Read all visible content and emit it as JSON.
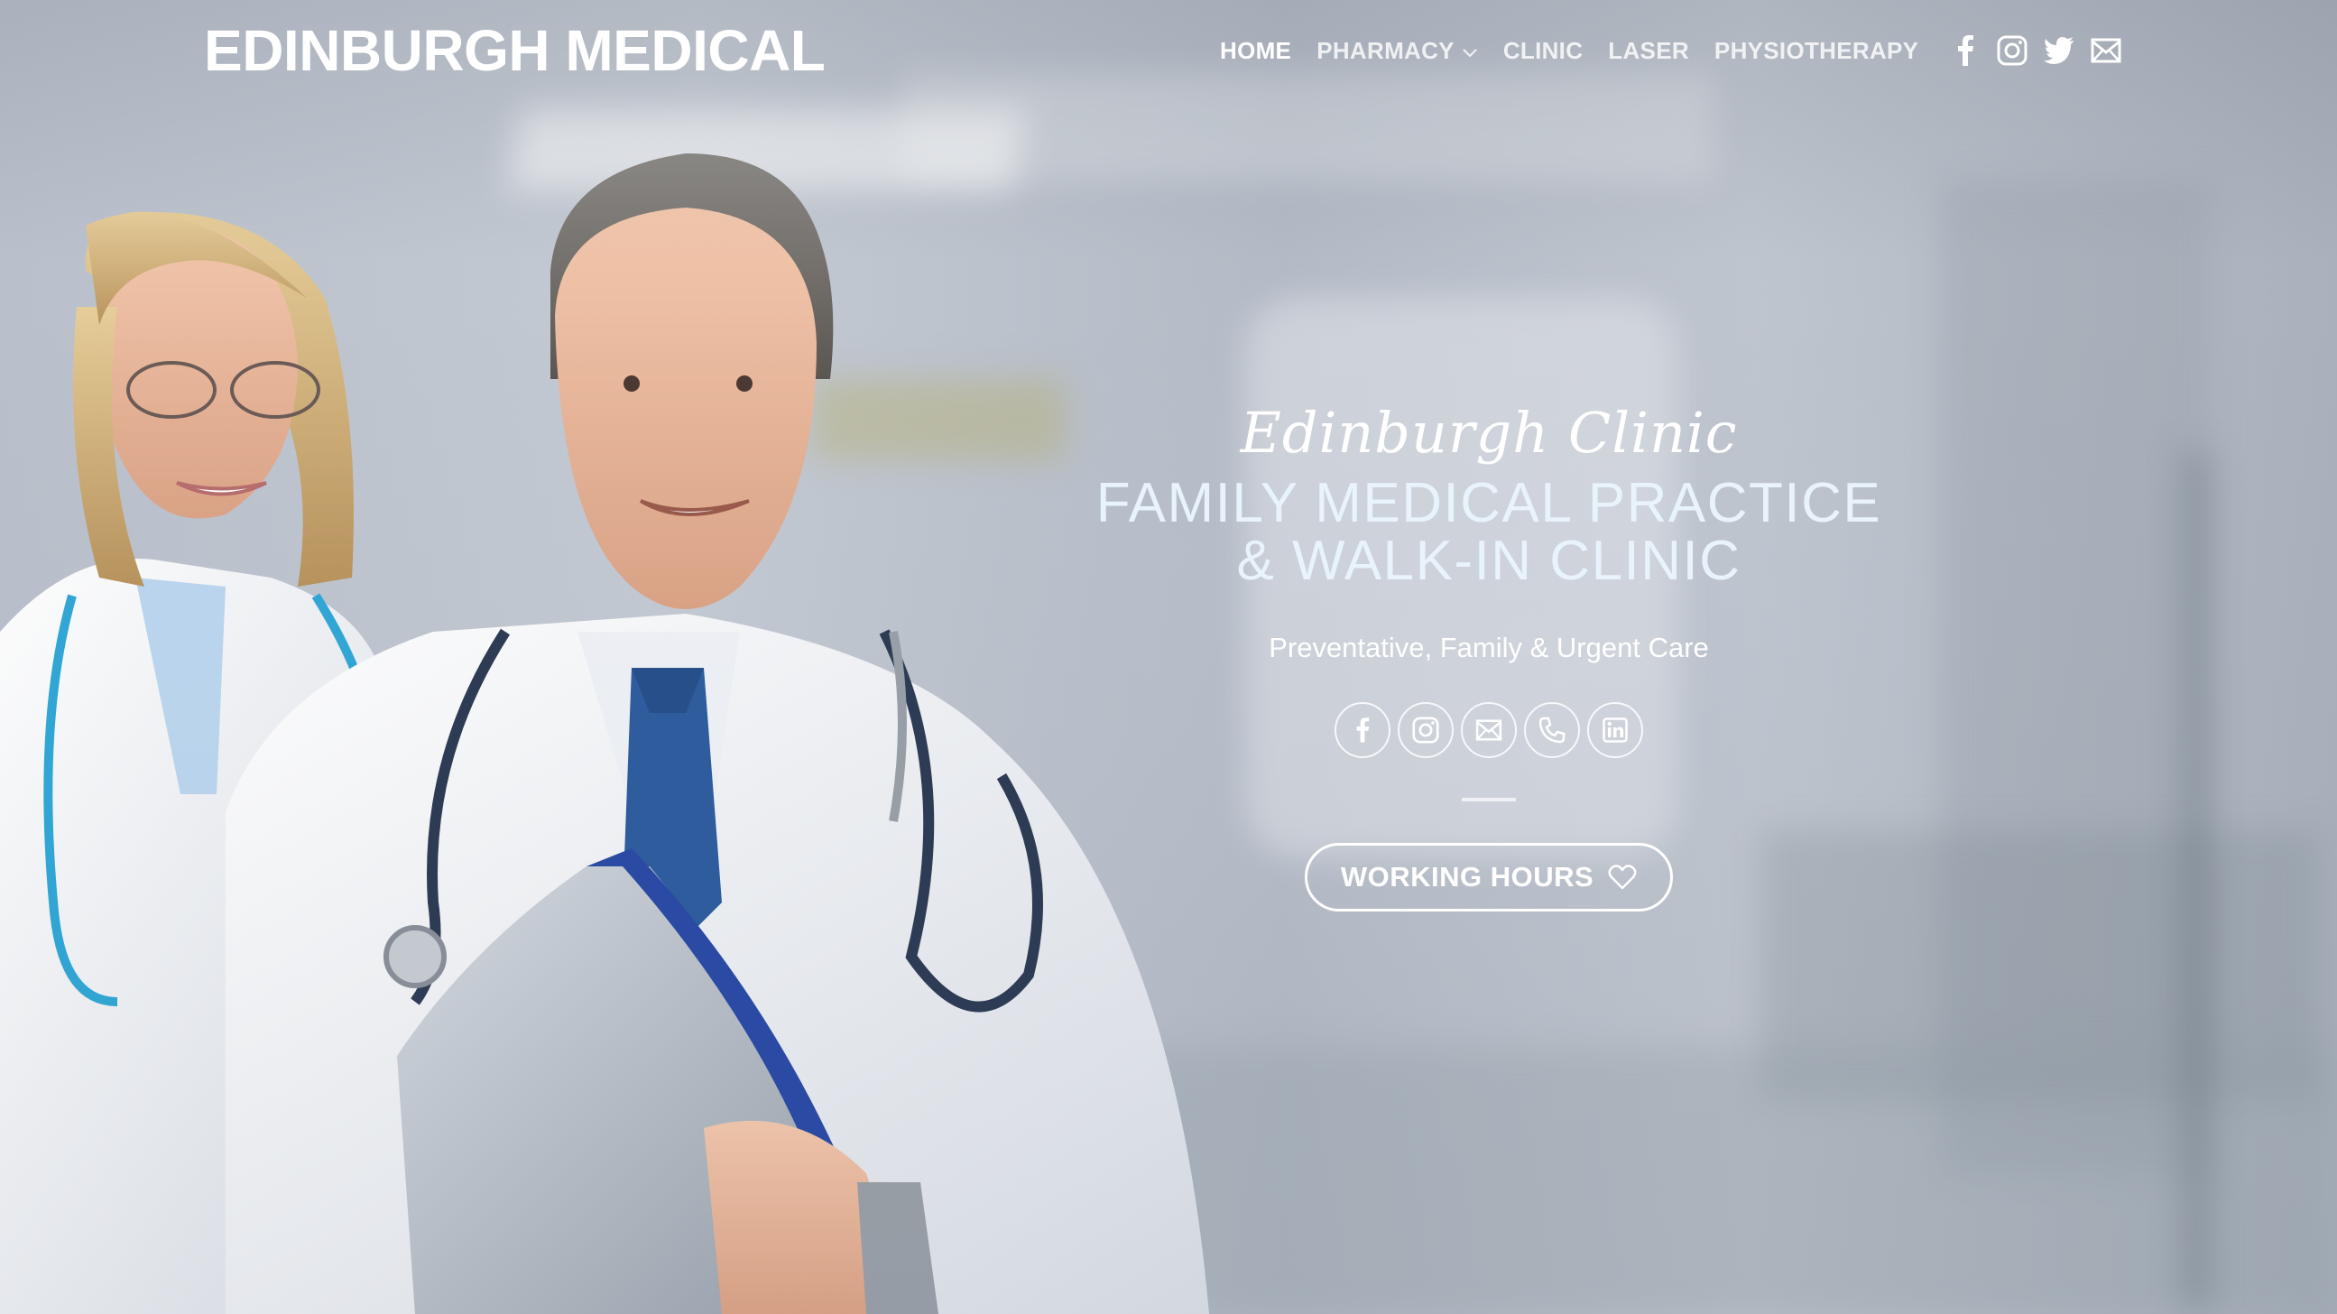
{
  "header": {
    "logo": "EDINBURGH MEDICAL",
    "nav": [
      {
        "label": "HOME",
        "active": true
      },
      {
        "label": "PHARMACY",
        "has_dropdown": true
      },
      {
        "label": "CLINIC"
      },
      {
        "label": "LASER"
      },
      {
        "label": "PHYSIOTHERAPY"
      }
    ],
    "icons": [
      "facebook-icon",
      "instagram-icon",
      "twitter-icon",
      "envelope-icon"
    ]
  },
  "hero": {
    "script_title": "Edinburgh Clinic",
    "headline_line1": "FAMILY MEDICAL PRACTICE",
    "headline_line2": "& WALK-IN CLINIC",
    "subtitle": "Preventative, Family & Urgent Care",
    "social_icons": [
      "facebook-icon",
      "instagram-icon",
      "envelope-icon",
      "phone-icon",
      "linkedin-icon"
    ],
    "cta_label": "WORKING HOURS",
    "cta_icon": "heart-icon"
  },
  "colors": {
    "text": "#ffffff",
    "headline": "#e9f3fb"
  }
}
